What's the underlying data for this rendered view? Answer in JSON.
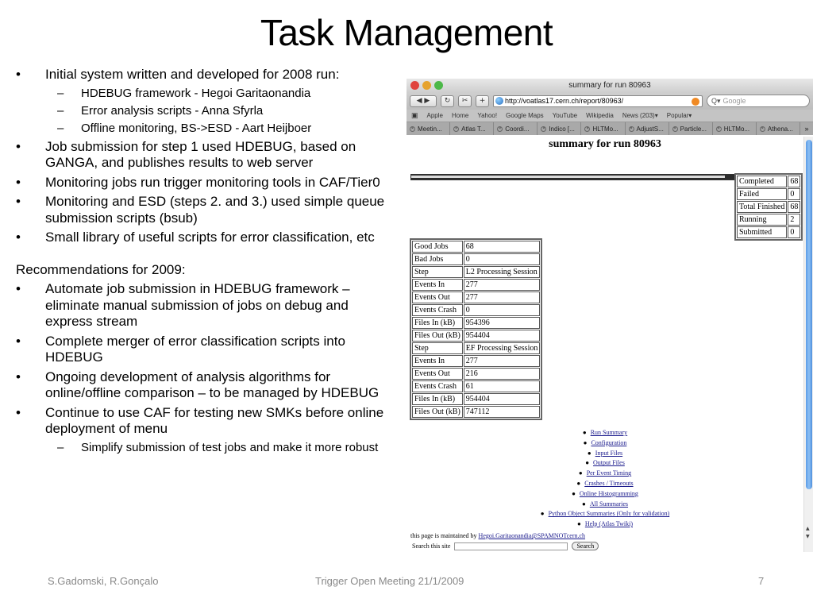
{
  "slide": {
    "title": "Task Management",
    "bullets": [
      {
        "text": "Initial system written and developed for 2008 run:",
        "subs": [
          "HDEBUG framework - Hegoi Garitaonandia",
          "Error analysis scripts - Anna Sfyrla",
          "Offline monitoring, BS->ESD - Aart Heijboer"
        ]
      },
      {
        "text": "Job submission for step 1 used HDEBUG, based on GANGA, and publishes results to web server"
      },
      {
        "text": "Monitoring jobs run trigger monitoring tools in CAF/Tier0"
      },
      {
        "text": "Monitoring and ESD (steps 2. and 3.) used simple queue submission scripts (bsub)"
      },
      {
        "text": "Small library of useful scripts for error classification, etc"
      }
    ],
    "recommendations_heading": "Recommendations for 2009:",
    "recommendations": [
      {
        "text": "Automate job submission in HDEBUG framework – eliminate manual submission of jobs on debug and express stream"
      },
      {
        "text": "Complete merger of error classification scripts into HDEBUG"
      },
      {
        "text": "Ongoing development of analysis algorithms for online/offline  comparison – to be managed by HDEBUG"
      },
      {
        "text": "Continue to use CAF for testing new SMKs before online deployment of menu",
        "subs": [
          "Simplify submission of test jobs and make it more robust"
        ]
      }
    ],
    "bullet_glyph": "•",
    "dash_glyph": "–"
  },
  "browser": {
    "window_title": "summary for run 80963",
    "url": "http://voatlas17.cern.ch/report/80963/",
    "search_placeholder": "Google",
    "search_prefix": "Q▾",
    "toolbar": {
      "back": "◀ ▶",
      "reload": "↻",
      "snap": "✂",
      "add": "+"
    },
    "bookmark_icon": "Ὅ6",
    "bookmarks": [
      "Apple",
      "Home",
      "Yahoo!",
      "Google Maps",
      "YouTube",
      "Wikipedia",
      "News (203)▾",
      "Popular▾"
    ],
    "tabs": [
      "Meetin...",
      "Atlas T...",
      "Coordi...",
      "Indico [...",
      "HLTMo...",
      "AdjustS...",
      "Particle...",
      "HLTMo...",
      "Athena..."
    ],
    "tab_overflow": "»",
    "page": {
      "title": "summary for run 80963",
      "progress_fraction": 0.97,
      "status_table": [
        [
          "Completed",
          "68"
        ],
        [
          "Failed",
          "0"
        ],
        [
          "Total Finished",
          "68"
        ],
        [
          "Running",
          "2"
        ],
        [
          "Submitted",
          "0"
        ]
      ],
      "jobs_table": [
        [
          "Good Jobs",
          "68"
        ],
        [
          "Bad Jobs",
          "0"
        ],
        [
          "Step",
          "L2 Processing Session"
        ],
        [
          "Events In",
          "277"
        ],
        [
          "Events Out",
          "277"
        ],
        [
          "Events Crash",
          "0"
        ],
        [
          "Files In (kB)",
          "954396"
        ],
        [
          "Files Out (kB)",
          "954404"
        ],
        [
          "Step",
          "EF Processing Session"
        ],
        [
          "Events In",
          "277"
        ],
        [
          "Events Out",
          "216"
        ],
        [
          "Events Crash",
          "61"
        ],
        [
          "Files In (kB)",
          "954404"
        ],
        [
          "Files Out (kB)",
          "747112"
        ]
      ],
      "links": [
        "Run Summary",
        "Configuration",
        "Input Files",
        "Output Files",
        "Per Event Timing",
        "Crashes / Timeouts",
        "Online Histogramming",
        "All Summaries",
        "Python Object Summaries (Only for validation)",
        "Help (Atlas Twiki)"
      ],
      "maintained_prefix": "this page is maintained by ",
      "maintainer_email": "Hegoi.Garitaonandia@SPAMNOTcern.ch",
      "search_label": "Search this site",
      "search_button": "Search"
    }
  },
  "footer": {
    "authors": "S.Gadomski, R.Gonçalo",
    "event": "Trigger Open Meeting 21/1/2009",
    "page_number": "7"
  }
}
